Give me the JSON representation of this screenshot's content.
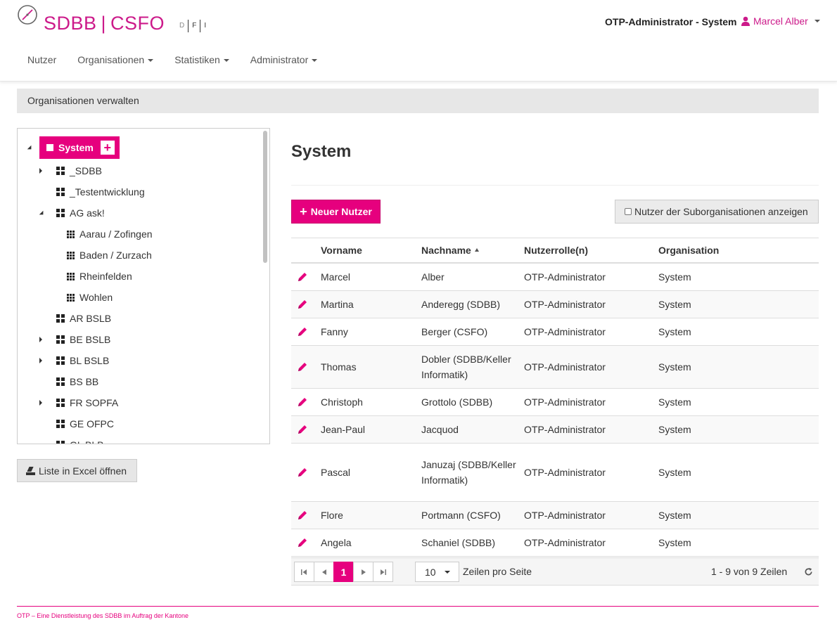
{
  "header": {
    "logo_text": "SDBB|CSFO",
    "languages": [
      "D",
      "F",
      "I"
    ],
    "context_title": "OTP-Administrator - System",
    "user_name": "Marcel Alber",
    "nav": [
      "Nutzer",
      "Organisationen",
      "Statistiken",
      "Administrator"
    ]
  },
  "breadcrumb": "Organisationen verwalten",
  "tree": {
    "root": "System",
    "nodes": [
      {
        "label": "_SDBB",
        "toggle": "collapsed",
        "icon": "grid4"
      },
      {
        "label": "_Testentwicklung",
        "toggle": "none",
        "icon": "grid4"
      },
      {
        "label": "AG ask!",
        "toggle": "expanded",
        "icon": "grid4"
      },
      {
        "label": "Aarau / Zofingen",
        "toggle": "none",
        "icon": "grid9"
      },
      {
        "label": "Baden / Zurzach",
        "toggle": "none",
        "icon": "grid9"
      },
      {
        "label": "Rheinfelden",
        "toggle": "none",
        "icon": "grid9"
      },
      {
        "label": "Wohlen",
        "toggle": "none",
        "icon": "grid9"
      },
      {
        "label": "AR BSLB",
        "toggle": "none",
        "icon": "grid4"
      },
      {
        "label": "BE BSLB",
        "toggle": "collapsed",
        "icon": "grid4"
      },
      {
        "label": "BL BSLB",
        "toggle": "collapsed",
        "icon": "grid4"
      },
      {
        "label": "BS BB",
        "toggle": "none",
        "icon": "grid4"
      },
      {
        "label": "FR SOPFA",
        "toggle": "collapsed",
        "icon": "grid4"
      },
      {
        "label": "GE OFPC",
        "toggle": "none",
        "icon": "grid4"
      },
      {
        "label": "GL BLB",
        "toggle": "none",
        "icon": "grid4"
      }
    ]
  },
  "excel_button": "Liste in Excel öffnen",
  "main": {
    "title": "System",
    "new_user_button": "Neuer Nutzer",
    "sub_orgs_toggle": "Nutzer der Suborganisationen anzeigen",
    "columns": [
      "Vorname",
      "Nachname",
      "Nutzerrolle(n)",
      "Organisation"
    ],
    "rows": [
      {
        "first": "Marcel",
        "last": "Alber",
        "role": "OTP-Administrator",
        "org": "System"
      },
      {
        "first": "Martina",
        "last": "Anderegg (SDBB)",
        "role": "OTP-Administrator",
        "org": "System"
      },
      {
        "first": "Fanny",
        "last": "Berger (CSFO)",
        "role": "OTP-Administrator",
        "org": "System"
      },
      {
        "first": "Thomas",
        "last": "Dobler (SDBB/Keller Informatik)",
        "role": "OTP-Administrator",
        "org": "System"
      },
      {
        "first": "Christoph",
        "last": "Grottolo (SDBB)",
        "role": "OTP-Administrator",
        "org": "System"
      },
      {
        "first": "Jean-Paul",
        "last": "Jacquod",
        "role": "OTP-Administrator",
        "org": "System"
      },
      {
        "first": "Pascal",
        "last": "Januzaj (SDBB/Keller Informatik)",
        "role": "OTP-Administrator",
        "org": "System"
      },
      {
        "first": "Flore",
        "last": "Portmann (CSFO)",
        "role": "OTP-Administrator",
        "org": "System"
      },
      {
        "first": "Angela",
        "last": "Schaniel (SDBB)",
        "role": "OTP-Administrator",
        "org": "System"
      }
    ],
    "pager": {
      "current_page": "1",
      "page_size": "10",
      "page_size_label": "Zeilen pro Seite",
      "count_text": "1 - 9 von 9 Zeilen"
    }
  },
  "footer": "OTP – Eine Dienstleistung des SDBB im Auftrag der Kantone",
  "colors": {
    "accent": "#e6007e",
    "brand": "#cc1a8a"
  }
}
